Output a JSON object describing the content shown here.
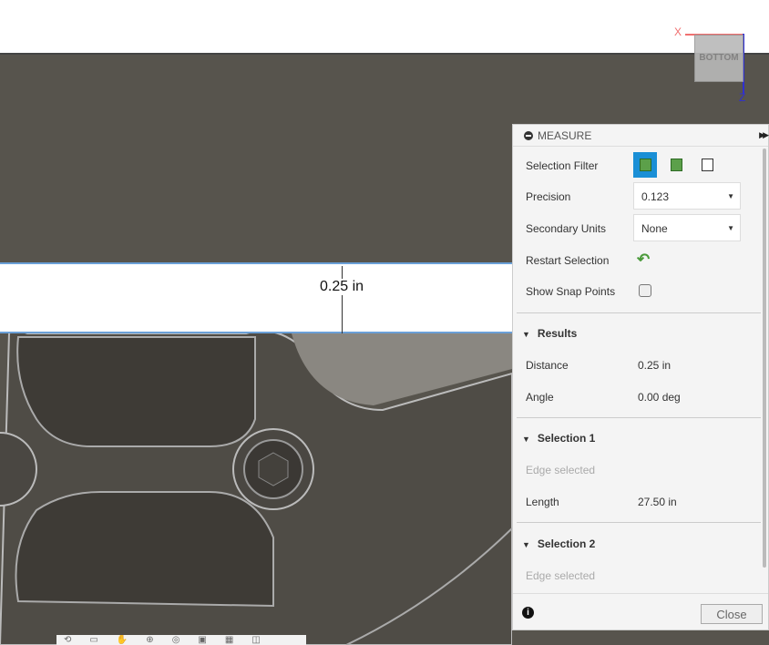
{
  "viewcube": {
    "face": "BOTTOM",
    "axis_x": "X",
    "axis_z": "Z"
  },
  "dimension": {
    "text": "0.25 in"
  },
  "panel": {
    "title": "MEASURE",
    "selection_filter_label": "Selection Filter",
    "precision_label": "Precision",
    "precision_value": "0.123",
    "secondary_units_label": "Secondary Units",
    "secondary_units_value": "None",
    "restart_label": "Restart Selection",
    "snap_label": "Show Snap Points",
    "snap_checked": false,
    "results": {
      "title": "Results",
      "distance_label": "Distance",
      "distance_value": "0.25 in",
      "angle_label": "Angle",
      "angle_value": "0.00 deg"
    },
    "selection1": {
      "title": "Selection 1",
      "status": "Edge selected",
      "length_label": "Length",
      "length_value": "27.50 in"
    },
    "selection2": {
      "title": "Selection 2",
      "status": "Edge selected"
    },
    "close_label": "Close",
    "accent": "#1a8fd6"
  }
}
